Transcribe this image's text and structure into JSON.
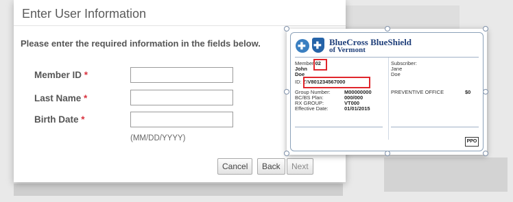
{
  "form": {
    "title": "Enter User Information",
    "instructions": "Please enter the required information in the fields below.",
    "required_marker": "*",
    "fields": [
      {
        "label": "Member ID",
        "value": ""
      },
      {
        "label": "Last Name",
        "value": ""
      },
      {
        "label": "Birth Date",
        "value": ""
      }
    ],
    "date_hint": "(MM/DD/YYYY)",
    "buttons": {
      "cancel": "Cancel",
      "back": "Back",
      "next": "Next"
    }
  },
  "card": {
    "brand_line1": "BlueCross BlueShield",
    "brand_line2": "of Vermont",
    "member_label": "Member:",
    "member_suffix": "02",
    "member_first": "John",
    "member_last": "Doe",
    "id_label": "ID: ZI",
    "id_value": "V801234567000",
    "subscriber_label": "Subscriber:",
    "subscriber_first": "Jane",
    "subscriber_last": "Doe",
    "details": [
      {
        "label": "Group Number:",
        "value": "M00000000"
      },
      {
        "label": "BC/BS Plan:",
        "value": "000/000"
      },
      {
        "label": "RX GROUP:",
        "value": "VT000"
      },
      {
        "label": "Effective Date:",
        "value": "01/01/2015"
      }
    ],
    "copay_label": "PREVENTIVE OFFICE",
    "copay_value": "$0",
    "plan_badge": "PPO"
  },
  "colors": {
    "required": "#d9333f",
    "highlight_box": "#e0252b",
    "brand_blue": "#1f3f7a"
  }
}
